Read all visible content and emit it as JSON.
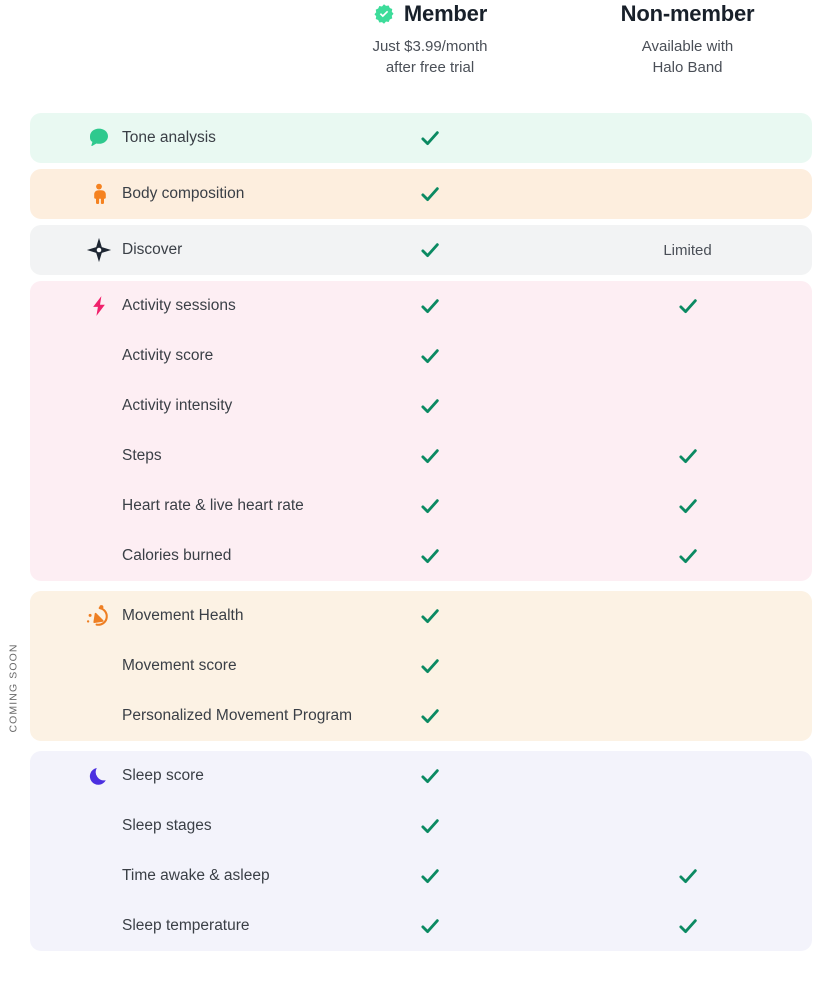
{
  "header": {
    "columns": [
      {
        "id": "member",
        "title": "Member",
        "icon": "verified-badge-icon",
        "subtitle_line1": "Just $3.99/month",
        "subtitle_line2": "after free trial"
      },
      {
        "id": "nonmember",
        "title": "Non-member",
        "icon": null,
        "subtitle_line1": "Available with",
        "subtitle_line2": "Halo Band"
      }
    ]
  },
  "coming_soon_label": "COMING SOON",
  "colors": {
    "check_green": "#0b8a62",
    "badge_green": "#3ddc9a",
    "tone_bg": "#e9f9f2",
    "tone_icon": "#2fc98e",
    "body_bg": "#fdeede",
    "body_icon": "#f58220",
    "discover_bg": "#f2f3f4",
    "discover_icon": "#1f2733",
    "activity_bg": "#fdeef3",
    "activity_icon": "#f0216b",
    "movement_bg": "#fcf2e4",
    "movement_icon": "#ee7f23",
    "sleep_bg": "#f3f3fb",
    "sleep_icon": "#4b2fe0",
    "text": "#3a3f46"
  },
  "limited_label": "Limited",
  "sections": [
    {
      "id": "tone",
      "bg_key": "tone_bg",
      "gap": "small",
      "rows": [
        {
          "label": "Tone analysis",
          "icon": "speech-bubble-icon",
          "icon_key": "tone_icon",
          "member": "check",
          "nonmember": "none"
        }
      ]
    },
    {
      "id": "body-composition",
      "bg_key": "body_bg",
      "gap": "small",
      "rows": [
        {
          "label": "Body composition",
          "icon": "person-icon",
          "icon_key": "body_icon",
          "member": "check",
          "nonmember": "none"
        }
      ]
    },
    {
      "id": "discover",
      "bg_key": "discover_bg",
      "gap": "small",
      "rows": [
        {
          "label": "Discover",
          "icon": "compass-star-icon",
          "icon_key": "discover_icon",
          "member": "check",
          "nonmember": "limited"
        }
      ]
    },
    {
      "id": "activity",
      "bg_key": "activity_bg",
      "gap": "large",
      "rows": [
        {
          "label": "Activity sessions",
          "icon": "lightning-bolt-icon",
          "icon_key": "activity_icon",
          "member": "check",
          "nonmember": "check"
        },
        {
          "label": "Activity score",
          "icon": null,
          "icon_key": null,
          "member": "check",
          "nonmember": "none"
        },
        {
          "label": "Activity intensity",
          "icon": null,
          "icon_key": null,
          "member": "check",
          "nonmember": "none"
        },
        {
          "label": "Steps",
          "icon": null,
          "icon_key": null,
          "member": "check",
          "nonmember": "check"
        },
        {
          "label": "Heart rate & live heart rate",
          "icon": null,
          "icon_key": null,
          "member": "check",
          "nonmember": "check"
        },
        {
          "label": "Calories burned",
          "icon": null,
          "icon_key": null,
          "member": "check",
          "nonmember": "check"
        }
      ]
    },
    {
      "id": "movement",
      "bg_key": "movement_bg",
      "gap": "large",
      "rows": [
        {
          "label": "Movement Health",
          "icon": "motion-figure-icon",
          "icon_key": "movement_icon",
          "member": "check",
          "nonmember": "none"
        },
        {
          "label": "Movement score",
          "icon": null,
          "icon_key": null,
          "member": "check",
          "nonmember": "none"
        },
        {
          "label": "Personalized Movement Program",
          "icon": null,
          "icon_key": null,
          "member": "check",
          "nonmember": "none"
        }
      ]
    },
    {
      "id": "sleep",
      "bg_key": "sleep_bg",
      "gap": "small",
      "rows": [
        {
          "label": "Sleep score",
          "icon": "crescent-moon-icon",
          "icon_key": "sleep_icon",
          "member": "check",
          "nonmember": "none"
        },
        {
          "label": "Sleep stages",
          "icon": null,
          "icon_key": null,
          "member": "check",
          "nonmember": "none"
        },
        {
          "label": "Time awake & asleep",
          "icon": null,
          "icon_key": null,
          "member": "check",
          "nonmember": "check"
        },
        {
          "label": "Sleep temperature",
          "icon": null,
          "icon_key": null,
          "member": "check",
          "nonmember": "check"
        }
      ]
    }
  ]
}
